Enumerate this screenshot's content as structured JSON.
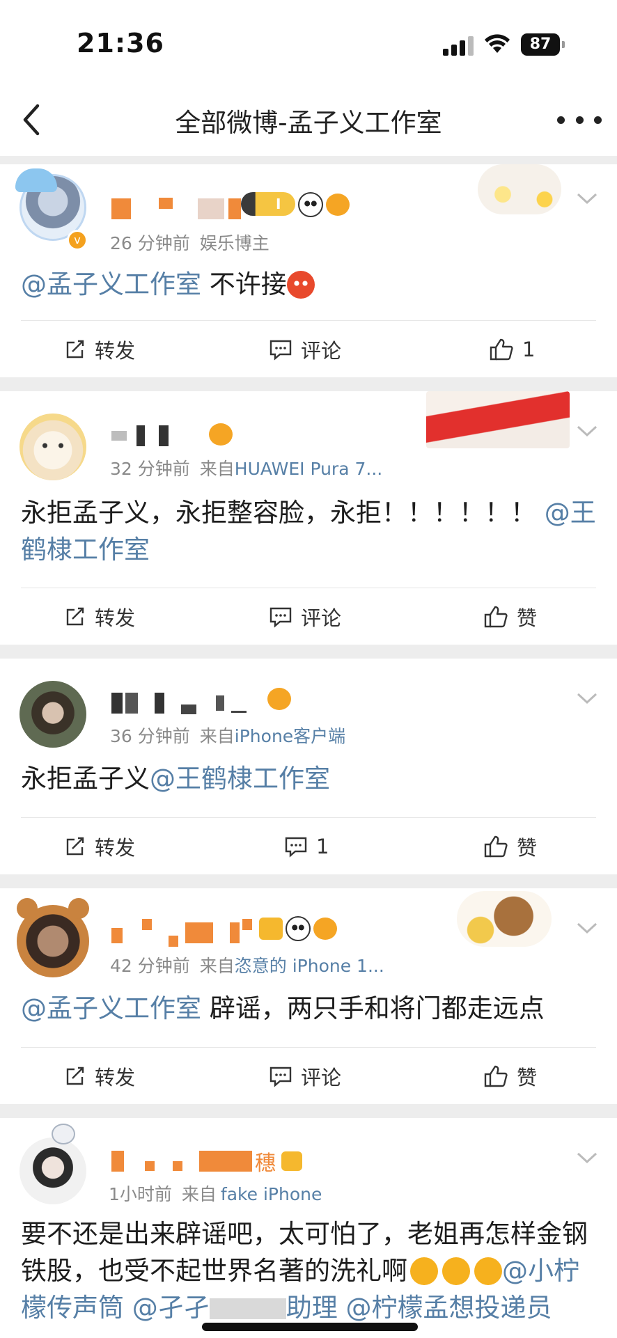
{
  "status_bar": {
    "time": "21:36",
    "battery": "87"
  },
  "nav": {
    "title": "全部微博-孟子义工作室"
  },
  "posts": [
    {
      "meta_time": "26 分钟前",
      "meta_source": "娱乐博主",
      "body_at": "@孟子义工作室",
      "body_text": " 不许接",
      "actions": {
        "repost": "转发",
        "comment": "评论",
        "like": "1"
      }
    },
    {
      "meta_time": "32 分钟前",
      "meta_source_prefix": "来自",
      "meta_source": "HUAWEI Pura 7...",
      "body_text": "永拒孟子义，永拒整容脸，永拒！！！！！！ ",
      "body_at": "@王鹤棣工作室",
      "actions": {
        "repost": "转发",
        "comment": "评论",
        "like": "赞"
      }
    },
    {
      "meta_time": "36 分钟前",
      "meta_source_prefix": "来自",
      "meta_source": "iPhone客户端",
      "body_text": "永拒孟子义",
      "body_at": "@王鹤棣工作室",
      "actions": {
        "repost": "转发",
        "comment": "1",
        "like": "赞"
      }
    },
    {
      "meta_time": "42 分钟前",
      "meta_source_prefix": "来自",
      "meta_source": "恣意的 iPhone 1...",
      "body_at": "@孟子义工作室",
      "body_text": " 辟谣，两只手和将门都走远点",
      "actions": {
        "repost": "转发",
        "comment": "评论",
        "like": "赞"
      }
    },
    {
      "name_suffix": "穗",
      "meta_time": "1小时前",
      "meta_source_prefix": "来自",
      "meta_source": "fake iPhone",
      "body_text": "要不还是出来辟谣吧，太可怕了，老姐再怎样金钢铁股，也受不起世界名著的洗礼啊",
      "body_at_1": "@",
      "body_at_2": "小柠檬传声筒",
      "body_at_3": "@孑孑",
      "body_at_4": "助理",
      "body_at_5": "@柠檬孟想投递员"
    }
  ],
  "colors": {
    "link": "#567fa6",
    "meta": "#8a8a8a",
    "blur_orange": "#f08a3a"
  },
  "icons": [
    "signal-icon",
    "wifi-icon",
    "battery-icon",
    "back-arrow-icon",
    "more-icon",
    "repost-icon",
    "comment-icon",
    "like-icon",
    "chevron-down-icon"
  ]
}
